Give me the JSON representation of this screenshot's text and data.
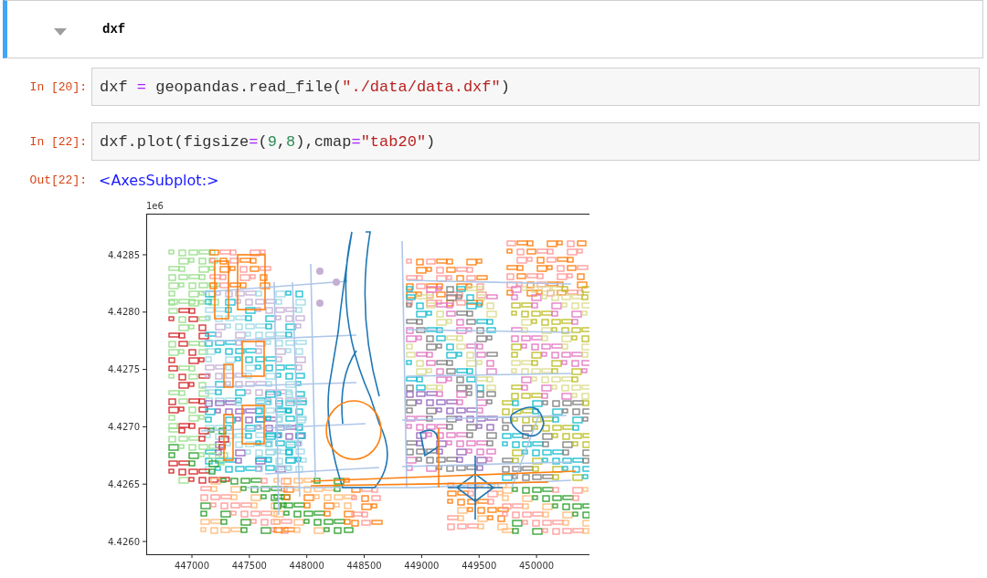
{
  "heading_cell": {
    "text": "dxf",
    "collapsed": false
  },
  "cells": [
    {
      "prompt": "In [20]:",
      "code": [
        {
          "kind": "name",
          "text": "dxf "
        },
        {
          "kind": "op",
          "text": "="
        },
        {
          "kind": "name",
          "text": " geopandas.read_file("
        },
        {
          "kind": "string",
          "text": "\"./data/data.dxf\""
        },
        {
          "kind": "name",
          "text": ")"
        }
      ]
    },
    {
      "prompt": "In [22]:",
      "code": [
        {
          "kind": "name",
          "text": "dxf.plot(figsize"
        },
        {
          "kind": "op",
          "text": "="
        },
        {
          "kind": "name",
          "text": "("
        },
        {
          "kind": "number",
          "text": "9"
        },
        {
          "kind": "name",
          "text": ","
        },
        {
          "kind": "number",
          "text": "8"
        },
        {
          "kind": "name",
          "text": "),cmap"
        },
        {
          "kind": "op",
          "text": "="
        },
        {
          "kind": "string",
          "text": "\"tab20\""
        },
        {
          "kind": "name",
          "text": ")"
        }
      ]
    }
  ],
  "output": {
    "prompt": "Out[22]:",
    "text": "<AxesSubplot:>",
    "plot": {
      "offset_label": "1e6",
      "yticks": [
        "4.4285",
        "4.4280",
        "4.4275",
        "4.4270",
        "4.4265",
        "4.4260"
      ],
      "xticks": [
        "447000",
        "447500",
        "448000",
        "448500",
        "449000",
        "449500",
        "450000"
      ]
    }
  }
}
